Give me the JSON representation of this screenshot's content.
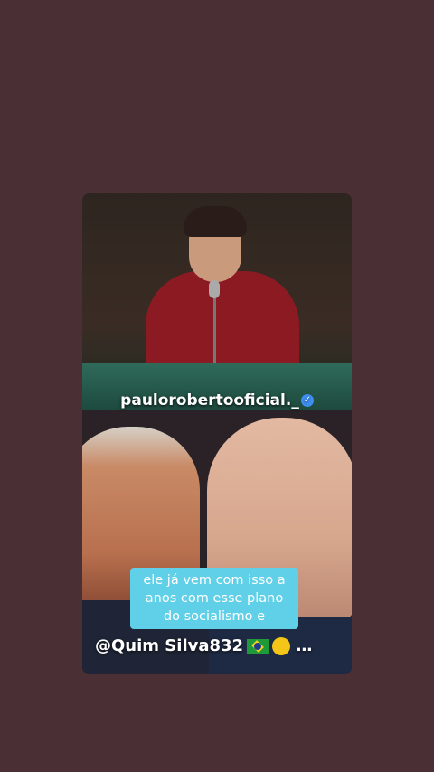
{
  "post": {
    "username": "paulorobertooficial._",
    "verified_icon": "verified-check-icon",
    "caption": "ele já vem com isso a anos  com esse plano do socialismo  e",
    "watermark": "@Quim Silva832",
    "watermark_trailing": "…"
  },
  "colors": {
    "background": "#4a3035",
    "caption_bg": "#5fd0e8",
    "verified": "#3f8ef2"
  }
}
